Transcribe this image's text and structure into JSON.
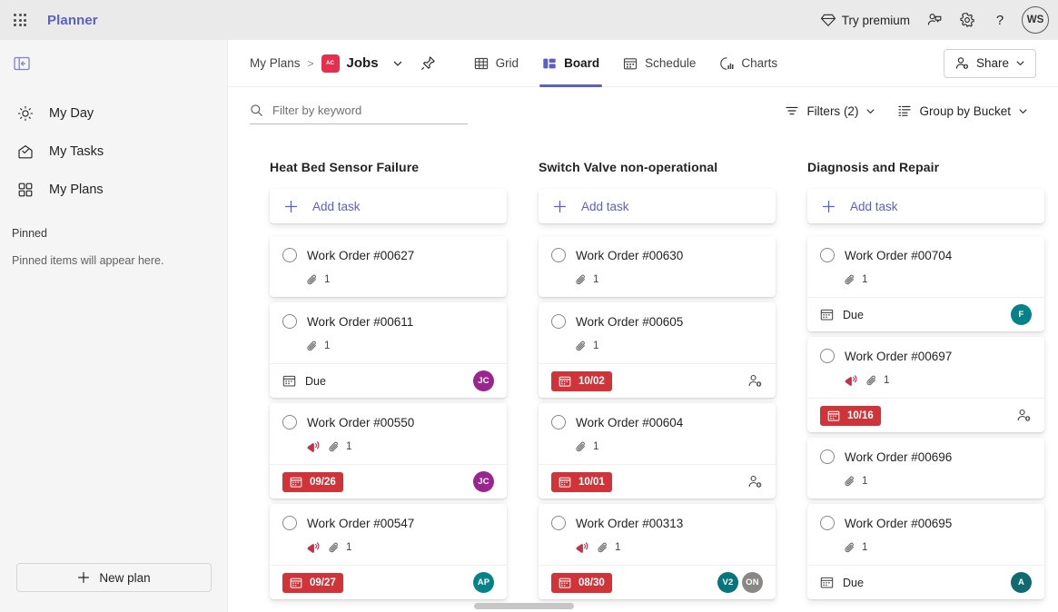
{
  "topbar": {
    "waffle_label": "app-launcher",
    "brand": "Planner",
    "try_premium": "Try premium",
    "avatar_initials": "WS"
  },
  "sidebar": {
    "items": [
      {
        "label": "My Day",
        "icon": "sun-icon"
      },
      {
        "label": "My Tasks",
        "icon": "tasks-inbox-icon"
      },
      {
        "label": "My Plans",
        "icon": "grid-icon"
      }
    ],
    "pinned_header": "Pinned",
    "pinned_empty": "Pinned items will appear here.",
    "new_plan": "New plan"
  },
  "command_bar": {
    "breadcrumb_root": "My Plans",
    "breadcrumb_sep": ">",
    "plan_chip_text": "AC",
    "plan_name": "Jobs",
    "tabs": [
      {
        "label": "Grid",
        "icon": "grid-table-icon",
        "active": false
      },
      {
        "label": "Board",
        "icon": "board-icon",
        "active": true
      },
      {
        "label": "Schedule",
        "icon": "calendar-icon",
        "active": false
      },
      {
        "label": "Charts",
        "icon": "chart-icon",
        "active": false
      }
    ],
    "share_label": "Share"
  },
  "filter_bar": {
    "search_placeholder": "Filter by keyword",
    "search_value": "",
    "filters_label": "Filters (2)",
    "group_by_label": "Group by Bucket"
  },
  "colors": {
    "accent": "#5b5fc7",
    "overdue": "#d13438",
    "plan_chip": "#e62e4d"
  },
  "board": {
    "add_task_label": "Add task",
    "buckets": [
      {
        "title": "Heat Bed Sensor Failure",
        "tasks": [
          {
            "title": "Work Order #00627",
            "urgent": false,
            "attachments": "1",
            "footer": "none"
          },
          {
            "title": "Work Order #00611",
            "urgent": false,
            "attachments": "1",
            "footer": "due",
            "due_label": "Due",
            "avatars": [
              {
                "initials": "JC",
                "color": "#9b258f"
              }
            ]
          },
          {
            "title": "Work Order #00550",
            "urgent": true,
            "attachments": "1",
            "footer": "date",
            "due_label": "09/26",
            "avatars": [
              {
                "initials": "JC",
                "color": "#9b258f"
              }
            ]
          },
          {
            "title": "Work Order #00547",
            "urgent": true,
            "attachments": "1",
            "footer": "date",
            "due_label": "09/27",
            "avatars": [
              {
                "initials": "AP",
                "color": "#038387"
              }
            ]
          }
        ]
      },
      {
        "title": "Switch Valve non-operational",
        "tasks": [
          {
            "title": "Work Order #00630",
            "urgent": false,
            "attachments": "1",
            "footer": "none"
          },
          {
            "title": "Work Order #00605",
            "urgent": false,
            "attachments": "1",
            "footer": "date",
            "due_label": "10/02",
            "avatars": []
          },
          {
            "title": "Work Order #00604",
            "urgent": false,
            "attachments": "1",
            "footer": "date",
            "due_label": "10/01",
            "avatars": []
          },
          {
            "title": "Work Order #00313",
            "urgent": true,
            "attachments": "1",
            "footer": "date",
            "due_label": "08/30",
            "avatars": [
              {
                "initials": "V2",
                "color": "#08757c"
              },
              {
                "initials": "ON",
                "color": "#8a8886"
              }
            ]
          }
        ]
      },
      {
        "title": "Diagnosis and Repair",
        "tasks": [
          {
            "title": "Work Order #00704",
            "urgent": false,
            "attachments": "1",
            "footer": "due",
            "due_label": "Due",
            "avatars": [
              {
                "initials": "F",
                "color": "#038387"
              }
            ]
          },
          {
            "title": "Work Order #00697",
            "urgent": true,
            "attachments": "1",
            "footer": "date",
            "due_label": "10/16",
            "avatars": []
          },
          {
            "title": "Work Order #00696",
            "urgent": false,
            "attachments": "1",
            "footer": "none"
          },
          {
            "title": "Work Order #00695",
            "urgent": false,
            "attachments": "1",
            "footer": "due",
            "due_label": "Due",
            "avatars": [
              {
                "initials": "A",
                "color": "#0f6b70"
              }
            ]
          }
        ]
      }
    ]
  }
}
